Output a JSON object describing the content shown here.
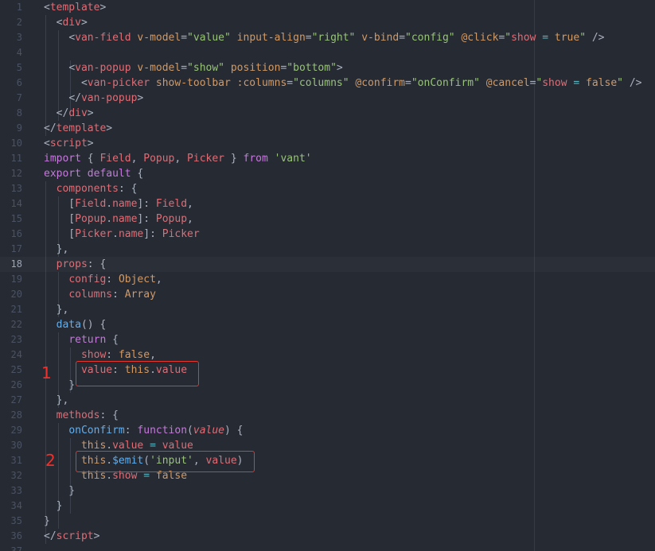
{
  "editor": {
    "active_line": 18,
    "lines": [
      {
        "n": "1",
        "segs": [
          [
            "t-punc",
            "<"
          ],
          [
            "t-tag",
            "template"
          ],
          [
            "t-punc",
            ">"
          ]
        ]
      },
      {
        "n": "2",
        "segs": [
          [
            "t-plain",
            "  "
          ],
          [
            "t-punc",
            "<"
          ],
          [
            "t-tag",
            "div"
          ],
          [
            "t-punc",
            ">"
          ]
        ]
      },
      {
        "n": "3",
        "segs": [
          [
            "t-plain",
            "    "
          ],
          [
            "t-punc",
            "<"
          ],
          [
            "t-tag",
            "van-field"
          ],
          [
            "t-plain",
            " "
          ],
          [
            "t-attr",
            "v-model"
          ],
          [
            "t-punc",
            "="
          ],
          [
            "t-str",
            "\"value\""
          ],
          [
            "t-plain",
            " "
          ],
          [
            "t-attr",
            "input-align"
          ],
          [
            "t-punc",
            "="
          ],
          [
            "t-str",
            "\"right\""
          ],
          [
            "t-plain",
            " "
          ],
          [
            "t-attr",
            "v-bind"
          ],
          [
            "t-punc",
            "="
          ],
          [
            "t-str",
            "\"config\""
          ],
          [
            "t-plain",
            " "
          ],
          [
            "t-attr",
            "@click"
          ],
          [
            "t-punc",
            "="
          ],
          [
            "t-str",
            "\""
          ],
          [
            "t-prop",
            "show"
          ],
          [
            "t-plain",
            " "
          ],
          [
            "t-op",
            "="
          ],
          [
            "t-plain",
            " "
          ],
          [
            "t-val",
            "true"
          ],
          [
            "t-str",
            "\""
          ],
          [
            "t-plain",
            " "
          ],
          [
            "t-punc",
            "/>"
          ]
        ]
      },
      {
        "n": "4",
        "segs": []
      },
      {
        "n": "5",
        "segs": [
          [
            "t-plain",
            "    "
          ],
          [
            "t-punc",
            "<"
          ],
          [
            "t-tag",
            "van-popup"
          ],
          [
            "t-plain",
            " "
          ],
          [
            "t-attr",
            "v-model"
          ],
          [
            "t-punc",
            "="
          ],
          [
            "t-str",
            "\"show\""
          ],
          [
            "t-plain",
            " "
          ],
          [
            "t-attr",
            "position"
          ],
          [
            "t-punc",
            "="
          ],
          [
            "t-str",
            "\"bottom\""
          ],
          [
            "t-punc",
            ">"
          ]
        ]
      },
      {
        "n": "6",
        "segs": [
          [
            "t-plain",
            "      "
          ],
          [
            "t-punc",
            "<"
          ],
          [
            "t-tag",
            "van-picker"
          ],
          [
            "t-plain",
            " "
          ],
          [
            "t-attr",
            "show-toolbar"
          ],
          [
            "t-plain",
            " "
          ],
          [
            "t-attr",
            ":columns"
          ],
          [
            "t-punc",
            "="
          ],
          [
            "t-str",
            "\"columns\""
          ],
          [
            "t-plain",
            " "
          ],
          [
            "t-attr",
            "@confirm"
          ],
          [
            "t-punc",
            "="
          ],
          [
            "t-str",
            "\"onConfirm\""
          ],
          [
            "t-plain",
            " "
          ],
          [
            "t-attr",
            "@cancel"
          ],
          [
            "t-punc",
            "="
          ],
          [
            "t-str",
            "\""
          ],
          [
            "t-prop",
            "show"
          ],
          [
            "t-plain",
            " "
          ],
          [
            "t-op",
            "="
          ],
          [
            "t-plain",
            " "
          ],
          [
            "t-val",
            "false"
          ],
          [
            "t-str",
            "\""
          ],
          [
            "t-plain",
            " "
          ],
          [
            "t-punc",
            "/>"
          ]
        ]
      },
      {
        "n": "7",
        "segs": [
          [
            "t-plain",
            "    "
          ],
          [
            "t-punc",
            "</"
          ],
          [
            "t-tag",
            "van-popup"
          ],
          [
            "t-punc",
            ">"
          ]
        ]
      },
      {
        "n": "8",
        "segs": [
          [
            "t-plain",
            "  "
          ],
          [
            "t-punc",
            "</"
          ],
          [
            "t-tag",
            "div"
          ],
          [
            "t-punc",
            ">"
          ]
        ]
      },
      {
        "n": "9",
        "segs": [
          [
            "t-punc",
            "</"
          ],
          [
            "t-tag",
            "template"
          ],
          [
            "t-punc",
            ">"
          ]
        ]
      },
      {
        "n": "10",
        "segs": [
          [
            "t-punc",
            "<"
          ],
          [
            "t-tag",
            "script"
          ],
          [
            "t-punc",
            ">"
          ]
        ]
      },
      {
        "n": "11",
        "segs": [
          [
            "t-kw",
            "import"
          ],
          [
            "t-plain",
            " { "
          ],
          [
            "t-prop",
            "Field"
          ],
          [
            "t-plain",
            ", "
          ],
          [
            "t-prop",
            "Popup"
          ],
          [
            "t-plain",
            ", "
          ],
          [
            "t-prop",
            "Picker"
          ],
          [
            "t-plain",
            " } "
          ],
          [
            "t-kw",
            "from"
          ],
          [
            "t-plain",
            " "
          ],
          [
            "t-str",
            "'vant'"
          ]
        ]
      },
      {
        "n": "12",
        "segs": [
          [
            "t-kw",
            "export"
          ],
          [
            "t-plain",
            " "
          ],
          [
            "t-kw",
            "default"
          ],
          [
            "t-plain",
            " {"
          ]
        ]
      },
      {
        "n": "13",
        "segs": [
          [
            "t-plain",
            "  "
          ],
          [
            "t-prop",
            "components"
          ],
          [
            "t-plain",
            ": {"
          ]
        ]
      },
      {
        "n": "14",
        "segs": [
          [
            "t-plain",
            "    ["
          ],
          [
            "t-prop",
            "Field"
          ],
          [
            "t-plain",
            "."
          ],
          [
            "t-prop",
            "name"
          ],
          [
            "t-plain",
            "]: "
          ],
          [
            "t-prop",
            "Field"
          ],
          [
            "t-plain",
            ","
          ]
        ]
      },
      {
        "n": "15",
        "segs": [
          [
            "t-plain",
            "    ["
          ],
          [
            "t-prop",
            "Popup"
          ],
          [
            "t-plain",
            "."
          ],
          [
            "t-prop",
            "name"
          ],
          [
            "t-plain",
            "]: "
          ],
          [
            "t-prop",
            "Popup"
          ],
          [
            "t-plain",
            ","
          ]
        ]
      },
      {
        "n": "16",
        "segs": [
          [
            "t-plain",
            "    ["
          ],
          [
            "t-prop",
            "Picker"
          ],
          [
            "t-plain",
            "."
          ],
          [
            "t-prop",
            "name"
          ],
          [
            "t-plain",
            "]: "
          ],
          [
            "t-prop",
            "Picker"
          ]
        ]
      },
      {
        "n": "17",
        "segs": [
          [
            "t-plain",
            "  },"
          ]
        ]
      },
      {
        "n": "18",
        "segs": [
          [
            "t-plain",
            "  "
          ],
          [
            "t-prop",
            "props"
          ],
          [
            "t-plain",
            ": {"
          ]
        ]
      },
      {
        "n": "19",
        "segs": [
          [
            "t-plain",
            "    "
          ],
          [
            "t-prop",
            "config"
          ],
          [
            "t-plain",
            ": "
          ],
          [
            "t-val",
            "Object"
          ],
          [
            "t-plain",
            ","
          ]
        ]
      },
      {
        "n": "20",
        "segs": [
          [
            "t-plain",
            "    "
          ],
          [
            "t-prop",
            "columns"
          ],
          [
            "t-plain",
            ": "
          ],
          [
            "t-val",
            "Array"
          ]
        ]
      },
      {
        "n": "21",
        "segs": [
          [
            "t-plain",
            "  },"
          ]
        ]
      },
      {
        "n": "22",
        "segs": [
          [
            "t-plain",
            "  "
          ],
          [
            "t-fn",
            "data"
          ],
          [
            "t-plain",
            "() {"
          ]
        ]
      },
      {
        "n": "23",
        "segs": [
          [
            "t-plain",
            "    "
          ],
          [
            "t-kw",
            "return"
          ],
          [
            "t-plain",
            " {"
          ]
        ]
      },
      {
        "n": "24",
        "segs": [
          [
            "t-plain",
            "      "
          ],
          [
            "t-prop",
            "show"
          ],
          [
            "t-plain",
            ": "
          ],
          [
            "t-val",
            "false"
          ],
          [
            "t-plain",
            ","
          ]
        ]
      },
      {
        "n": "25",
        "segs": [
          [
            "t-plain",
            "      "
          ],
          [
            "t-prop",
            "value"
          ],
          [
            "t-plain",
            ": "
          ],
          [
            "t-val",
            "this"
          ],
          [
            "t-plain",
            "."
          ],
          [
            "t-prop",
            "value"
          ]
        ]
      },
      {
        "n": "26",
        "segs": [
          [
            "t-plain",
            "    }"
          ]
        ]
      },
      {
        "n": "27",
        "segs": [
          [
            "t-plain",
            "  },"
          ]
        ]
      },
      {
        "n": "28",
        "segs": [
          [
            "t-plain",
            "  "
          ],
          [
            "t-prop",
            "methods"
          ],
          [
            "t-plain",
            ": {"
          ]
        ]
      },
      {
        "n": "29",
        "segs": [
          [
            "t-plain",
            "    "
          ],
          [
            "t-fn",
            "onConfirm"
          ],
          [
            "t-plain",
            ": "
          ],
          [
            "t-kw",
            "function"
          ],
          [
            "t-plain",
            "("
          ],
          [
            "t-ital",
            "value"
          ],
          [
            "t-plain",
            ") {"
          ]
        ]
      },
      {
        "n": "30",
        "segs": [
          [
            "t-plain",
            "      "
          ],
          [
            "t-val",
            "this"
          ],
          [
            "t-plain",
            "."
          ],
          [
            "t-prop",
            "value"
          ],
          [
            "t-plain",
            " "
          ],
          [
            "t-op",
            "="
          ],
          [
            "t-plain",
            " "
          ],
          [
            "t-prop",
            "value"
          ]
        ]
      },
      {
        "n": "31",
        "segs": [
          [
            "t-plain",
            "      "
          ],
          [
            "t-val",
            "this"
          ],
          [
            "t-plain",
            "."
          ],
          [
            "t-fn",
            "$emit"
          ],
          [
            "t-plain",
            "("
          ],
          [
            "t-str",
            "'input'"
          ],
          [
            "t-plain",
            ", "
          ],
          [
            "t-prop",
            "value"
          ],
          [
            "t-plain",
            ")"
          ]
        ]
      },
      {
        "n": "32",
        "segs": [
          [
            "t-plain",
            "      "
          ],
          [
            "t-val",
            "this"
          ],
          [
            "t-plain",
            "."
          ],
          [
            "t-prop",
            "show"
          ],
          [
            "t-plain",
            " "
          ],
          [
            "t-op",
            "="
          ],
          [
            "t-plain",
            " "
          ],
          [
            "t-val",
            "false"
          ]
        ]
      },
      {
        "n": "33",
        "segs": [
          [
            "t-plain",
            "    }"
          ]
        ]
      },
      {
        "n": "34",
        "segs": [
          [
            "t-plain",
            "  }"
          ]
        ]
      },
      {
        "n": "35",
        "segs": [
          [
            "t-plain",
            "}"
          ]
        ]
      },
      {
        "n": "36",
        "segs": [
          [
            "t-punc",
            "</"
          ],
          [
            "t-tag",
            "script"
          ],
          [
            "t-punc",
            ">"
          ]
        ]
      },
      {
        "n": "37",
        "segs": []
      }
    ]
  },
  "annotations": {
    "marker_1": "1",
    "marker_2": "2"
  },
  "colors": {
    "background": "#262a33",
    "annotation_red": "#e8342d"
  }
}
